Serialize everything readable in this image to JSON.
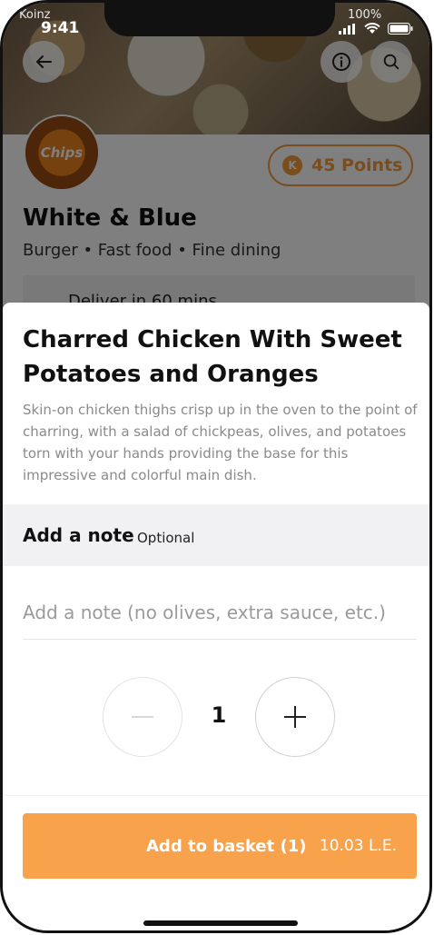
{
  "status_bar": {
    "carrier": "Koinz",
    "time": "9:41",
    "battery_pct": "100%"
  },
  "restaurant": {
    "logo_text": "Chips",
    "name": "White & Blue",
    "tags": "Burger • Fast food • Fine dining",
    "points_label": "45 Points",
    "points_icon": "K",
    "delivery_text": "Deliver in 60 mins"
  },
  "dish": {
    "title": "Charred Chicken With Sweet Potatoes and Oranges",
    "description": "Skin-on chicken thighs crisp up in the oven to the point of charring, with a salad of chickpeas, olives, and potatoes torn with your hands providing the base for this impressive and colorful main dish."
  },
  "note": {
    "title": "Add a note",
    "optional_label": "Optional",
    "placeholder": "Add a note (no olives, extra sauce, etc.)"
  },
  "quantity": {
    "value": "1"
  },
  "basket": {
    "label": "Add to basket (1)",
    "price": "10.03 L.E."
  },
  "colors": {
    "accent": "#f9a24c",
    "points": "#f29a3a"
  }
}
